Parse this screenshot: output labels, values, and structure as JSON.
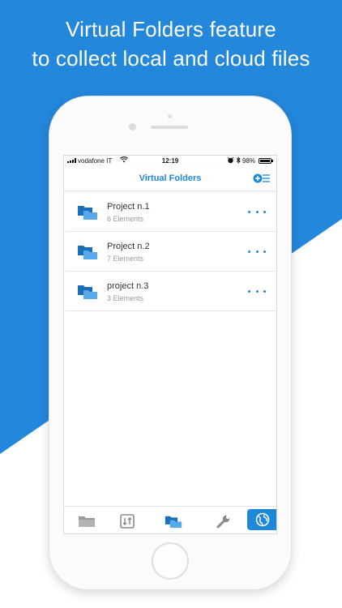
{
  "promo": {
    "headline_line1": "Virtual Folders feature",
    "headline_line2": "to collect local and cloud files"
  },
  "colors": {
    "accent": "#1e88d8",
    "background_blue": "#2387dc",
    "folder_dark": "#1a6fb8",
    "folder_light": "#58a9ec"
  },
  "status_bar": {
    "carrier": "vodafone IT",
    "time": "12:19",
    "battery": "98%"
  },
  "nav": {
    "title": "Virtual Folders",
    "action_icon": "add-list-icon"
  },
  "folders": [
    {
      "name": "Project n.1",
      "count": "6 Elements",
      "icon": "folder-icon"
    },
    {
      "name": "Project n.2",
      "count": "7 Elements",
      "icon": "folder-icon"
    },
    {
      "name": "project n.3",
      "count": "3 Elements",
      "icon": "folder-icon"
    }
  ],
  "tabs": [
    {
      "icon": "folder-icon",
      "active": false
    },
    {
      "icon": "transfer-icon",
      "active": false
    },
    {
      "icon": "virtual-folders-icon",
      "active": false
    },
    {
      "icon": "wrench-icon",
      "active": false
    },
    {
      "icon": "globe-icon",
      "active": true
    }
  ]
}
